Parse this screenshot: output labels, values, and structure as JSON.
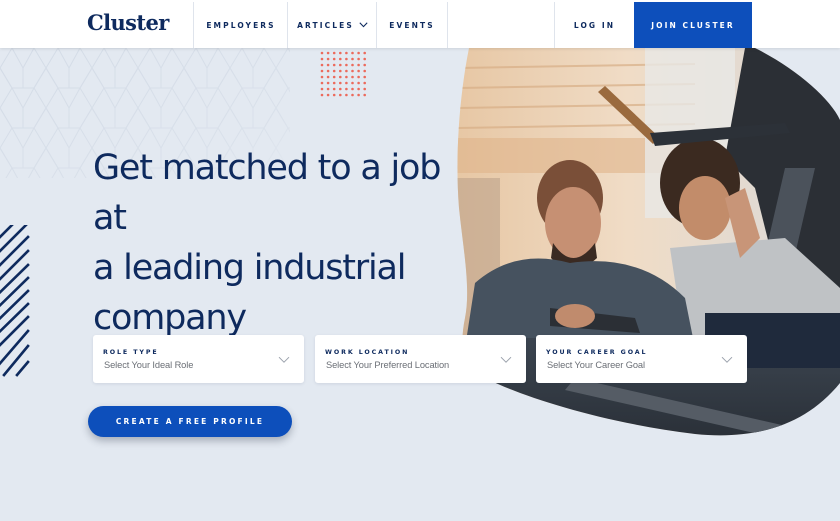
{
  "header": {
    "logo": "Cluster",
    "nav": {
      "employers": "EMPLOYERS",
      "articles": "ARTICLES",
      "events": "EVENTS",
      "login": "LOG IN",
      "join": "JOIN CLUSTER"
    }
  },
  "hero": {
    "headline_line1": "Get matched to a job at",
    "headline_line2": "a leading industrial",
    "headline_line3": "company",
    "photo_alt": "Two men inspecting a drone in a workshop"
  },
  "form": {
    "fields": [
      {
        "label": "ROLE TYPE",
        "value": "Select Your Ideal Role"
      },
      {
        "label": "WORK LOCATION",
        "value": "Select Your Preferred Location"
      },
      {
        "label": "YOUR CAREER GOAL",
        "value": "Select Your Career Goal"
      }
    ],
    "cta": "CREATE A FREE PROFILE"
  },
  "colors": {
    "brand_navy": "#0e2a5e",
    "accent_blue": "#0d4fbb",
    "background": "#e3e9f1",
    "dot_accent": "#ec6a5c"
  },
  "icons": {
    "articles_dropdown": "chevron-down-icon",
    "select_dropdown": "chevron-down-icon"
  }
}
